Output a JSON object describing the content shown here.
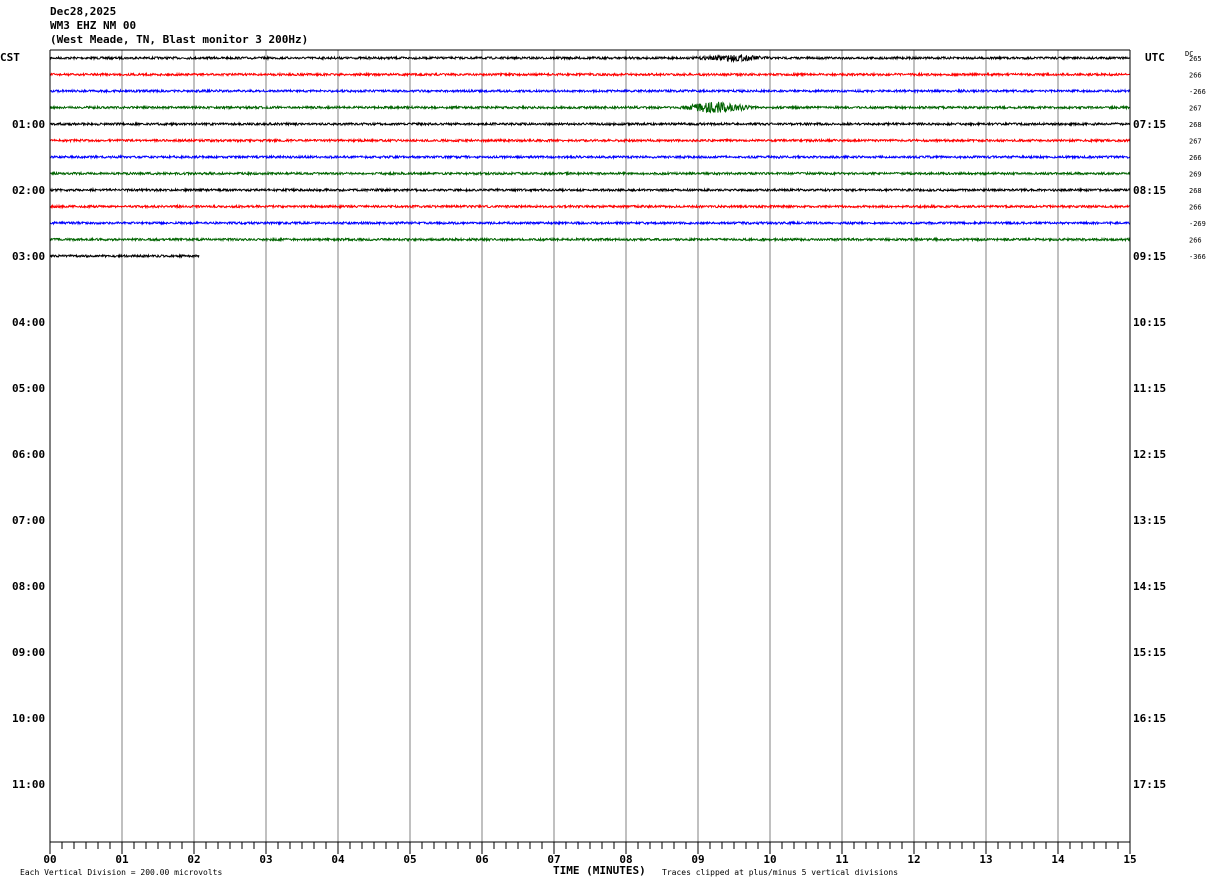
{
  "header": {
    "date": "Dec28,2025",
    "station": "WM3 EHZ NM 00",
    "location": "(West Meade, TN, Blast monitor 3 200Hz)"
  },
  "left_axis_title": "CST",
  "right_axis_title": "UTC",
  "dc_label": "DC",
  "footer": {
    "vertical_division": "Each Vertical Division =  200.00 microvolts",
    "xlabel": "TIME (MINUTES)",
    "clip_note": "Traces clipped at plus/minus 5 vertical divisions"
  },
  "chart_data": {
    "type": "line",
    "title": "",
    "xlabel": "TIME (MINUTES)",
    "xlim": [
      0,
      15
    ],
    "x_ticks": [
      "00",
      "01",
      "02",
      "03",
      "04",
      "05",
      "06",
      "07",
      "08",
      "09",
      "10",
      "11",
      "12",
      "13",
      "14",
      "15"
    ],
    "grid": "vertical lines every minute",
    "left_hour_labels": [
      "01:00",
      "02:00",
      "03:00",
      "04:00",
      "05:00",
      "06:00",
      "07:00",
      "08:00",
      "09:00",
      "10:00",
      "11:00"
    ],
    "right_hour_labels": [
      "07:15",
      "08:15",
      "09:15",
      "10:15",
      "11:15",
      "12:15",
      "13:15",
      "14:15",
      "15:15",
      "16:15",
      "17:15"
    ],
    "row_count": 48,
    "row_colors": [
      "#000000",
      "#ff0000",
      "#0000ff",
      "#006400"
    ],
    "trace_rows": [
      {
        "row": 0,
        "color": "#000000",
        "end_min": 15,
        "dc": "265"
      },
      {
        "row": 1,
        "color": "#ff0000",
        "end_min": 15,
        "dc": "266"
      },
      {
        "row": 2,
        "color": "#0000ff",
        "end_min": 15,
        "dc": "-266"
      },
      {
        "row": 3,
        "color": "#006400",
        "end_min": 15,
        "dc": "267"
      },
      {
        "row": 4,
        "color": "#000000",
        "end_min": 15,
        "dc": "268"
      },
      {
        "row": 5,
        "color": "#ff0000",
        "end_min": 15,
        "dc": "267"
      },
      {
        "row": 6,
        "color": "#0000ff",
        "end_min": 15,
        "dc": "266"
      },
      {
        "row": 7,
        "color": "#006400",
        "end_min": 15,
        "dc": "269"
      },
      {
        "row": 8,
        "color": "#000000",
        "end_min": 15,
        "dc": "268"
      },
      {
        "row": 9,
        "color": "#ff0000",
        "end_min": 15,
        "dc": "266"
      },
      {
        "row": 10,
        "color": "#0000ff",
        "end_min": 15,
        "dc": "-269"
      },
      {
        "row": 11,
        "color": "#006400",
        "end_min": 15,
        "dc": "266"
      },
      {
        "row": 12,
        "color": "#000000",
        "end_min": 2.07,
        "dc": "-366"
      }
    ],
    "events": [
      {
        "row": 0,
        "minute": 9.5,
        "amplitude": "small"
      },
      {
        "row": 3,
        "minute": 9.25,
        "amplitude": "medium"
      }
    ]
  }
}
